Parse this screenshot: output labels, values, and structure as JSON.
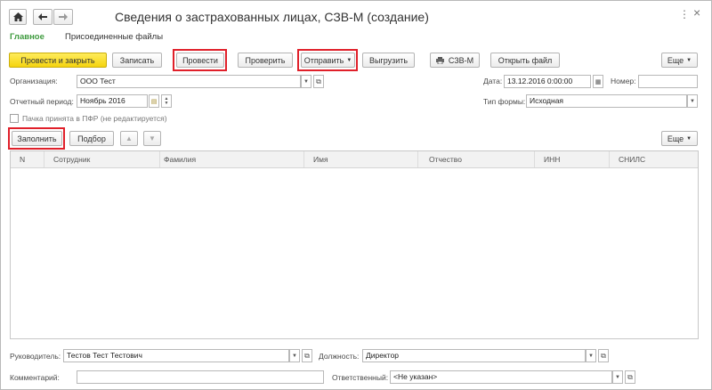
{
  "window": {
    "title": "Сведения о застрахованных лицах, СЗВ-М (создание)",
    "close_glyph": "×",
    "more_glyph": "⋮"
  },
  "nav": {
    "home_icon": "home-icon",
    "back_icon": "arrow-left-icon",
    "forward_icon": "arrow-right-icon"
  },
  "tabs": {
    "main": "Главное",
    "attached": "Присоединенные файлы"
  },
  "toolbar": {
    "post_close": "Провести и закрыть",
    "save": "Записать",
    "post": "Провести",
    "check": "Проверить",
    "send": "Отправить",
    "export": "Выгрузить",
    "szvm": "СЗВ-М",
    "open_file": "Открыть файл",
    "more": "Еще"
  },
  "header_fields": {
    "org_label": "Организация:",
    "org_value": "ООО Тест",
    "date_label": "Дата:",
    "date_value": "13.12.2016  0:00:00",
    "number_label": "Номер:",
    "number_value": "",
    "period_label": "Отчетный период:",
    "period_value": "Ноябрь 2016",
    "form_type_label": "Тип формы:",
    "form_type_value": "Исходная",
    "accepted_label": "Пачка принята в ПФР (не редактируется)"
  },
  "table_toolbar": {
    "fill": "Заполнить",
    "pick": "Подбор",
    "more": "Еще"
  },
  "table": {
    "columns": [
      "N",
      "Сотрудник",
      "Фамилия",
      "Имя",
      "Отчество",
      "ИНН",
      "СНИЛС"
    ],
    "rows": []
  },
  "footer": {
    "head_label": "Руководитель:",
    "head_value": "Тестов Тест Тестович",
    "position_label": "Должность:",
    "position_value": "Директор",
    "comment_label": "Комментарий:",
    "comment_value": "",
    "responsible_label": "Ответственный:",
    "responsible_value": "<Не указан>"
  },
  "colors": {
    "accent_green": "#3f9b3f",
    "primary_yellow": "#f5d40f",
    "highlight_red": "#e0202a"
  }
}
